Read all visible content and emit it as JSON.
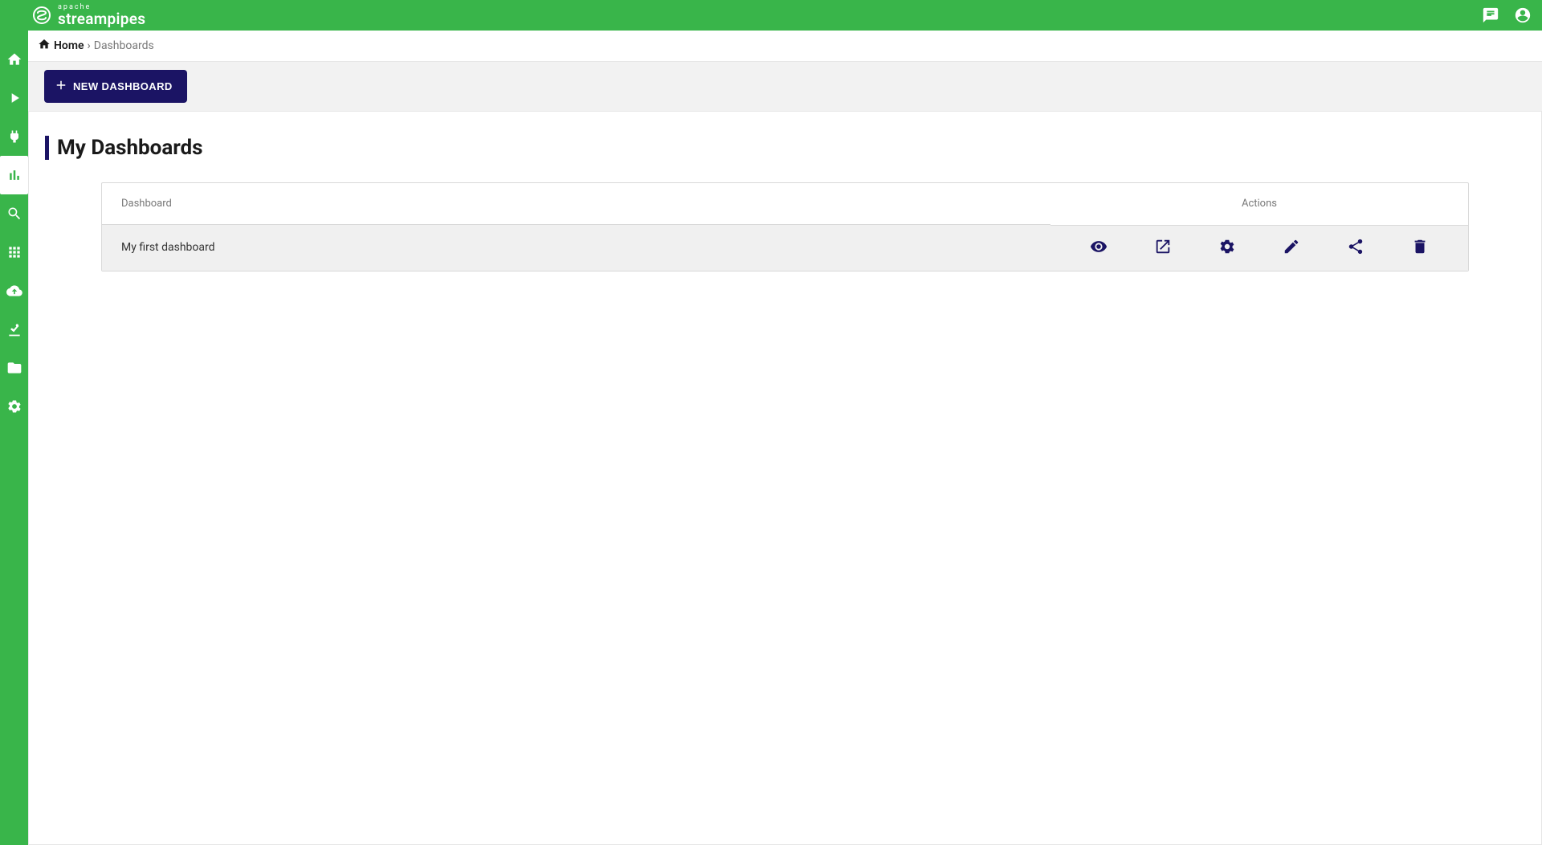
{
  "brand": {
    "small": "apache",
    "big": "streampipes"
  },
  "breadcrumb": {
    "home": "Home",
    "current": "Dashboards"
  },
  "toolbar": {
    "new_dashboard": "NEW DASHBOARD"
  },
  "section": {
    "title": "My Dashboards"
  },
  "table": {
    "headers": {
      "name": "Dashboard",
      "actions": "Actions"
    },
    "rows": [
      {
        "name": "My first dashboard"
      }
    ]
  },
  "sidebar": {
    "items": [
      {
        "name": "home"
      },
      {
        "name": "play"
      },
      {
        "name": "plug"
      },
      {
        "name": "dashboards",
        "active": true
      },
      {
        "name": "search"
      },
      {
        "name": "apps"
      },
      {
        "name": "cloud-download"
      },
      {
        "name": "robot-arm"
      },
      {
        "name": "folder"
      },
      {
        "name": "settings"
      }
    ]
  }
}
